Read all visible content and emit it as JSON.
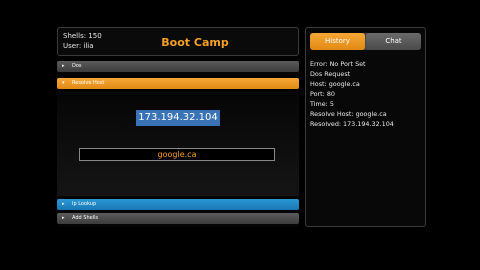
{
  "header": {
    "shells": "Shells: 150",
    "user": "User: ilia",
    "title": "Boot Camp"
  },
  "accordion": {
    "dos": "Dos",
    "resolve_host": "Resolve Host",
    "ip_lookup": "Ip Lookup",
    "add_shells": "Add Shells",
    "arrow_collapsed": "▸",
    "arrow_expanded": "▾"
  },
  "resolve": {
    "ip": "173.194.32.104",
    "host_value": "google.ca"
  },
  "side": {
    "tabs": [
      "History",
      "Chat"
    ],
    "active_tab": "History",
    "log": [
      "Error: No Port Set",
      "Dos Request",
      "Host: google.ca",
      "Port: 80",
      "Time: 5",
      "Resolve Host: google.ca",
      "Resolved: 173.194.32.104"
    ]
  },
  "colors": {
    "accent": "#f5a024",
    "selection": "#3a73b5",
    "info": "#2b97d6"
  }
}
